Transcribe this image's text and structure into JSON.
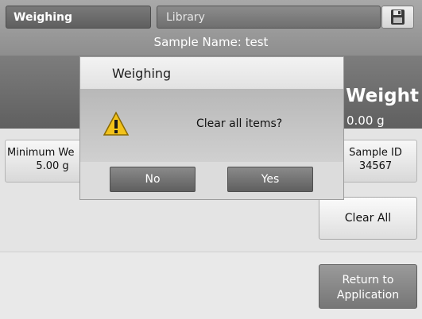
{
  "header": {
    "tab_active": "Weighing",
    "tab_library": "Library",
    "save_icon": "floppy-disk-icon",
    "sample_name": "Sample Name: test"
  },
  "result": {
    "title_fragment": "n Weight",
    "value": "0.00 g"
  },
  "fields": {
    "minimum_weight_label": "Minimum We",
    "minimum_weight_value": "5.00 g",
    "sample_id_label": "Sample ID",
    "sample_id_value": "34567"
  },
  "actions": {
    "clear_all": "Clear All",
    "return_line1": "Return to",
    "return_line2": "Application"
  },
  "dialog": {
    "title": "Weighing",
    "message": "Clear all items?",
    "icon": "warning-icon",
    "no": "No",
    "yes": "Yes"
  },
  "colors": {
    "warning_yellow": "#f2c21a",
    "header_gray": "#8e8e8e",
    "button_dark": "#6f6f6f"
  }
}
